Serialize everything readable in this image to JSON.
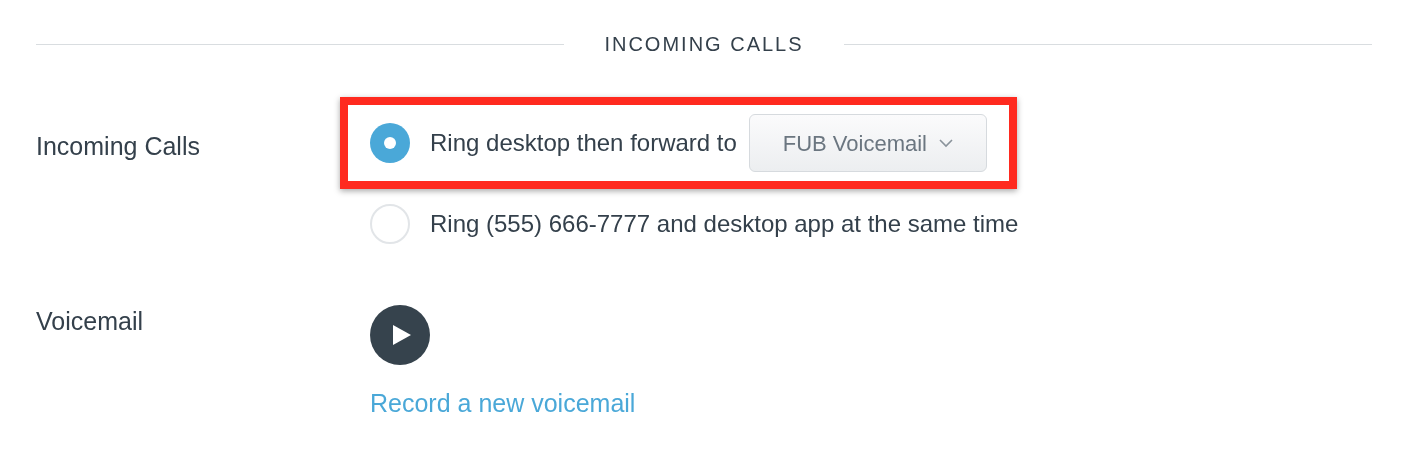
{
  "section_heading": "INCOMING CALLS",
  "incoming_calls": {
    "label": "Incoming Calls",
    "options": [
      {
        "kind": "forward",
        "selected": true,
        "highlighted": true,
        "text": "Ring desktop then forward to",
        "dropdown": "FUB Voicemail"
      },
      {
        "kind": "plain",
        "selected": false,
        "highlighted": false,
        "text": "Ring (555) 666-7777 and desktop app at the same time"
      }
    ]
  },
  "voicemail": {
    "label": "Voicemail",
    "link": "Record a new voicemail"
  }
}
